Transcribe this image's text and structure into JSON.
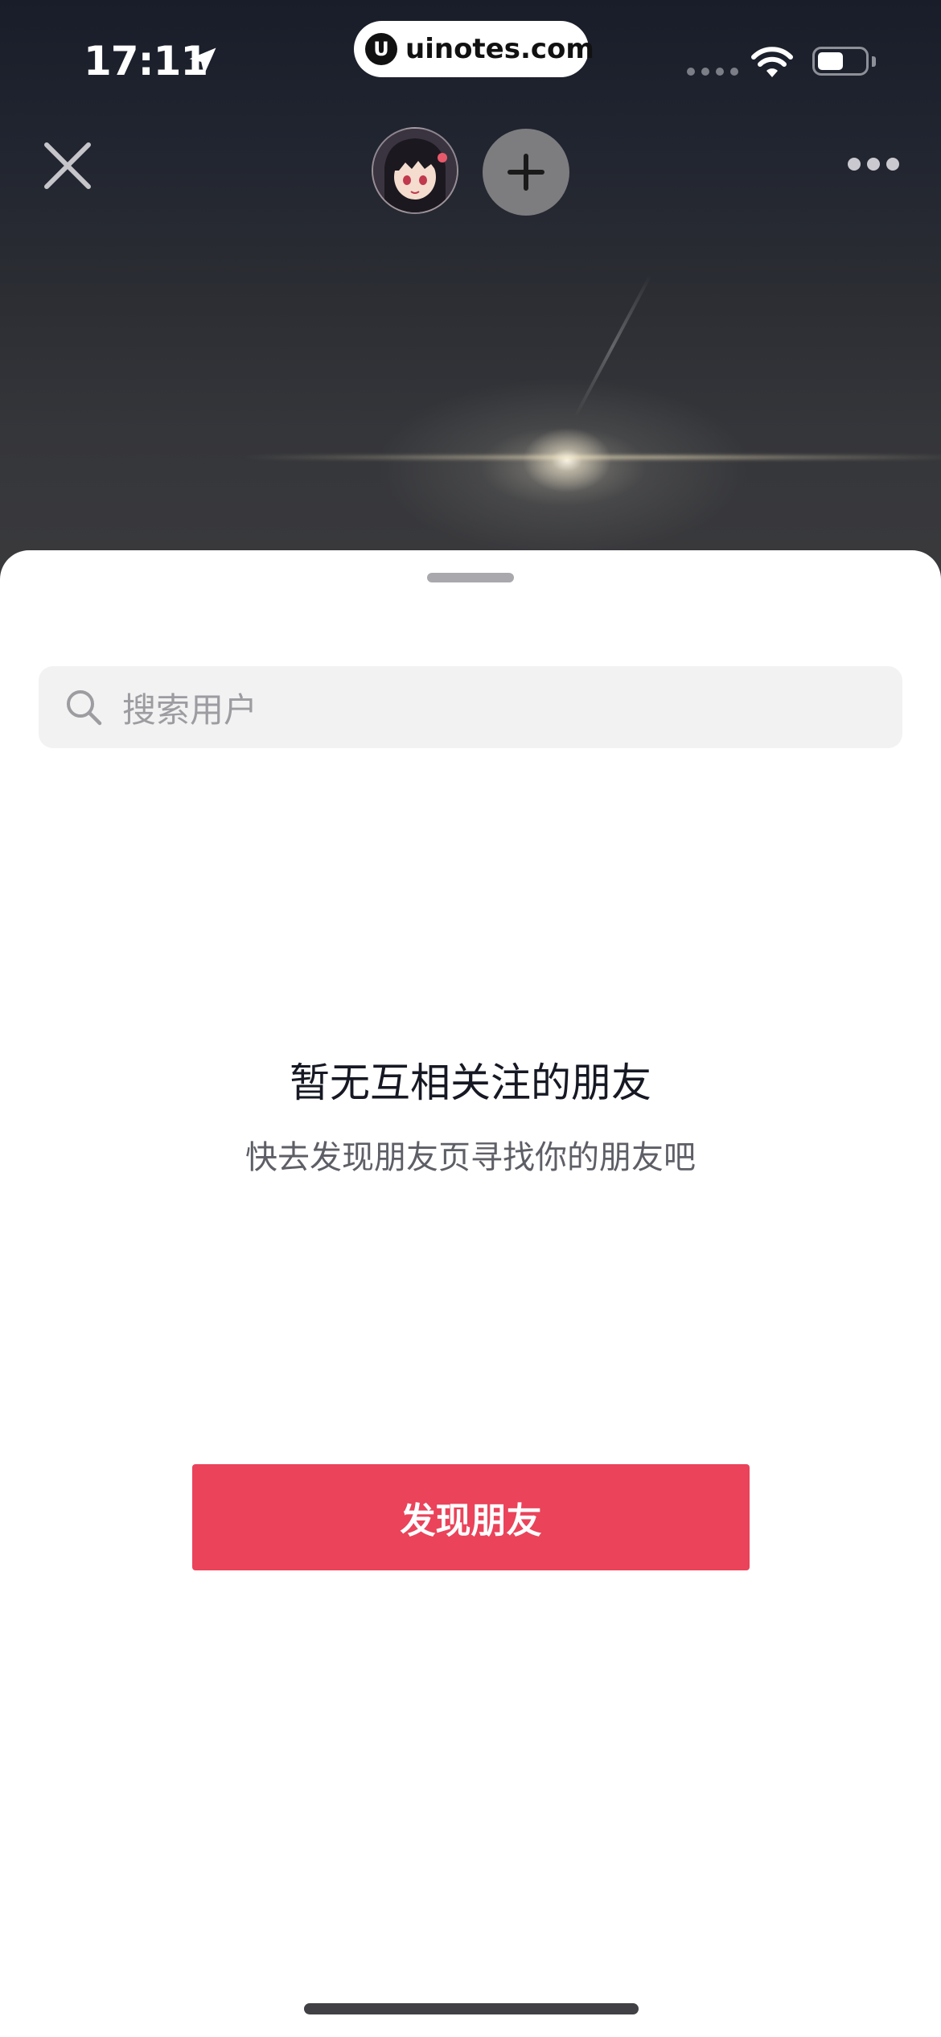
{
  "status_bar": {
    "time": "17:11",
    "url": "uinotes.com",
    "url_logo_letter": "U",
    "battery_level": 0.55
  },
  "top_nav": {
    "close_icon": "close-icon",
    "avatar_icon": "avatar",
    "add_icon": "plus-icon",
    "more_icon": "more-icon"
  },
  "sheet": {
    "search": {
      "placeholder": "搜索用户"
    },
    "empty_state": {
      "title": "暂无互相关注的朋友",
      "subtitle": "快去发现朋友页寻找你的朋友吧"
    },
    "primary_button": {
      "label": "发现朋友"
    }
  },
  "colors": {
    "accent": "#ea435a",
    "search_bg": "#f2f2f2",
    "title_text": "#161823",
    "subtitle_text": "#5e5f66"
  }
}
